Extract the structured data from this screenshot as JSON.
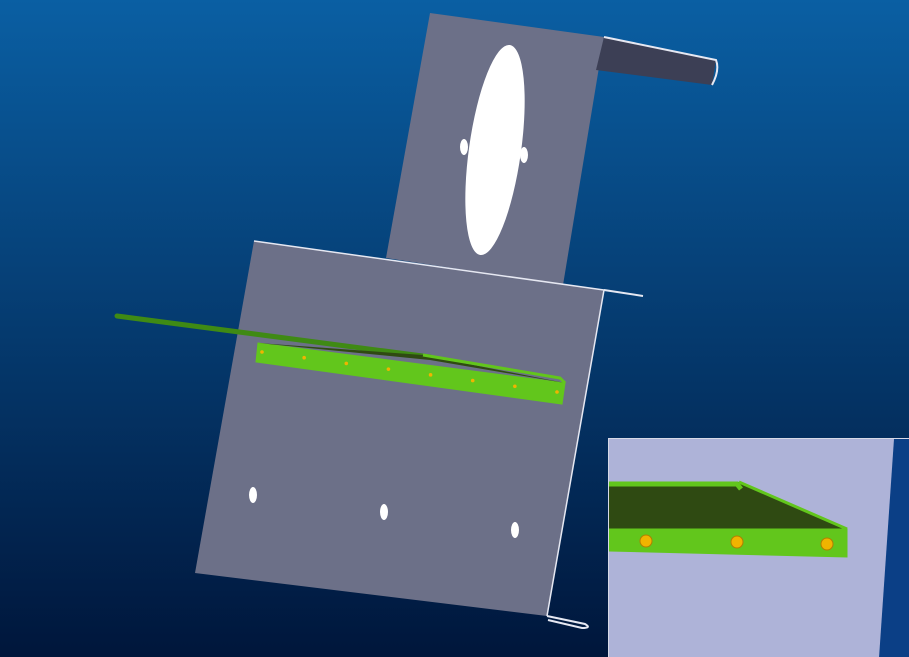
{
  "scene": {
    "background_top": "#0a5fa3",
    "background_bottom": "#00163b",
    "sheet_metal_color": "#6c7088",
    "sheet_metal_edge": "#e6e8f2",
    "hole_color": "#ffffff",
    "green_part_color": "#62c61c",
    "green_part_dark": "#2f4a12",
    "rod_color": "#3f8a14",
    "rivet_color": "#f0b400",
    "parts": [
      "main-plate",
      "upper-bracket",
      "green-angle-bar",
      "green-rod"
    ]
  },
  "inset": {
    "background": "#aeb3d8",
    "shows": "rivet-detail"
  }
}
